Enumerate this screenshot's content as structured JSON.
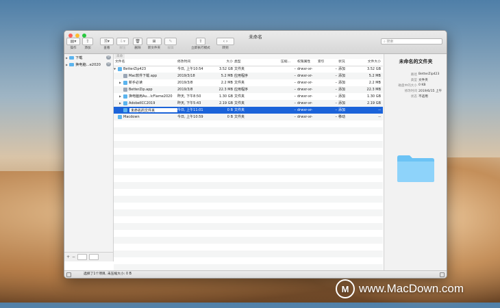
{
  "window": {
    "title": "未命名"
  },
  "toolbar": {
    "items": [
      {
        "label": "操作",
        "glyph": "▤▾"
      },
      {
        "label": "添加",
        "glyph": "⇪"
      },
      {
        "label": "查看",
        "glyph": "🗎▾"
      },
      {
        "label": "解压",
        "glyph": "⇩▾"
      },
      {
        "label": "删除",
        "glyph": "🗑"
      },
      {
        "label": "新文件夹",
        "glyph": "⊞"
      },
      {
        "label": "编辑",
        "glyph": "✎"
      },
      {
        "label": "立即执行模式",
        "glyph": "⇧"
      },
      {
        "label": "转到",
        "glyph": "‹ ›"
      }
    ],
    "search_placeholder": "搜索"
  },
  "sidebar": {
    "items": [
      {
        "label": "下载",
        "count": "0"
      },
      {
        "label": "换电脑...e2020",
        "count": "0"
      }
    ],
    "bottom": {
      "add": "+",
      "remove": "−"
    }
  },
  "pathbar": {
    "tab": "未命"
  },
  "columns": [
    "文件名",
    "修改时间",
    "大小",
    "类型",
    "压缩...",
    "权限属性",
    "索引",
    "状况",
    "文件大小"
  ],
  "rows": [
    {
      "name": "BetterZip423",
      "date": "今日, 上午10:54",
      "size": "3.52 GB",
      "kind": "文件夹",
      "comp": "",
      "perm": "drwxr-xr-",
      "idx": "",
      "state": "添加",
      "fsize": "3.52 GB",
      "level": 0,
      "tri": "▼",
      "icon": "folder"
    },
    {
      "name": "Mac软件下载.app",
      "date": "2019/3/18",
      "size": "5.2 MB",
      "kind": "应用程序",
      "comp": "",
      "perm": "drwxr-xr-",
      "idx": "",
      "state": "添加",
      "fsize": "5.2 MB",
      "level": 1,
      "tri": "",
      "icon": "app"
    },
    {
      "name": "新手必读",
      "date": "2019/3/8",
      "size": "2.2 MB",
      "kind": "文件夹",
      "comp": "",
      "perm": "drwxr-xr-",
      "idx": "",
      "state": "添加",
      "fsize": "2.2 MB",
      "level": 1,
      "tri": "▶",
      "icon": "folder"
    },
    {
      "name": "BetterZip.app",
      "date": "2019/3/8",
      "size": "22.3 MB",
      "kind": "应用程序",
      "comp": "",
      "perm": "drwxr-xr-",
      "idx": "",
      "state": "添加",
      "fsize": "22.3 MB",
      "level": 1,
      "tri": "",
      "icon": "app"
    },
    {
      "name": "换电脑用Au...lcFlame2020",
      "date": "昨天, 下午8:50",
      "size": "1.30 GB",
      "kind": "文件夹",
      "comp": "",
      "perm": "drwxr-xr-",
      "idx": "",
      "state": "添加",
      "fsize": "1.30 GB",
      "level": 1,
      "tri": "▶",
      "icon": "folder"
    },
    {
      "name": "AdobeIlCC2019",
      "date": "昨天, 下午5:43",
      "size": "2.19 GB",
      "kind": "文件夹",
      "comp": "",
      "perm": "drwxr-xr-",
      "idx": "",
      "state": "添加",
      "fsize": "2.19 GB",
      "level": 1,
      "tri": "▶",
      "icon": "folder"
    },
    {
      "name": "未命名的文件夹",
      "date": "今日, 上午11:01",
      "size": "0 B",
      "kind": "文件夹",
      "comp": "",
      "perm": "drwxr-xr-",
      "idx": "",
      "state": "添加",
      "fsize": "--",
      "level": 1,
      "tri": "",
      "icon": "folder",
      "selected": true
    },
    {
      "name": "Macdown",
      "date": "今日, 上午10:59",
      "size": "0 B",
      "kind": "文件夹",
      "comp": "",
      "perm": "drwxr-xr-",
      "idx": "",
      "state": "移动",
      "fsize": "--",
      "level": 0,
      "tri": "",
      "icon": "folder"
    }
  ],
  "inspector": {
    "title": "未命名的文件夹",
    "fields": [
      {
        "k": "路径",
        "v": "BetterZip423"
      },
      {
        "k": "类型",
        "v": "文件夹"
      },
      {
        "k": "磁盘中的大小",
        "v": "0 KB"
      },
      {
        "k": "修改时间",
        "v": "2019/6/15 上午"
      },
      {
        "k": "状态",
        "v": "不适用"
      }
    ]
  },
  "status": {
    "text": "选择了1个项目, 未压缩大小: 0 B"
  },
  "watermark": {
    "logo": "M",
    "text": "www.MacDown.com"
  },
  "colors": {
    "selection": "#1b63d9",
    "folder": "#5bb4ee",
    "badge": "#9aa3ad"
  }
}
